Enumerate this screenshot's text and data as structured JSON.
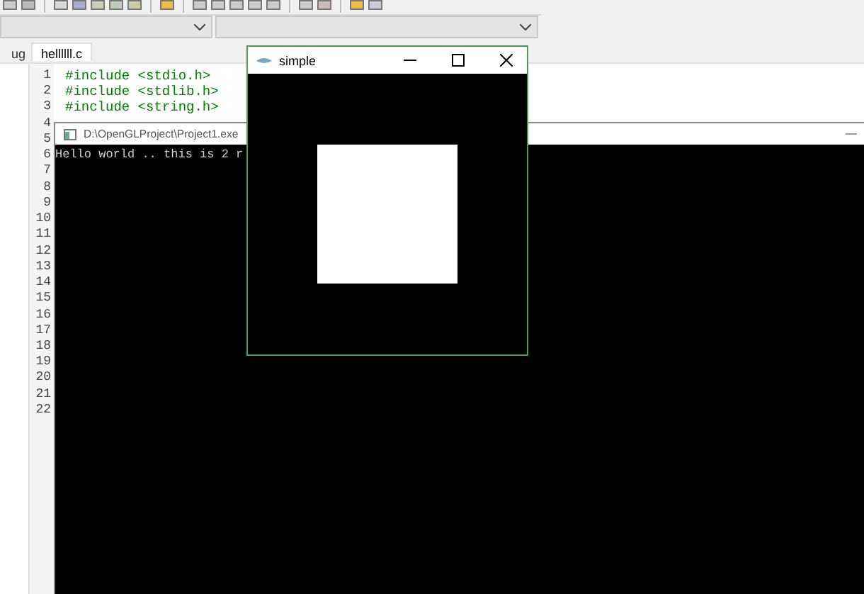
{
  "ide": {
    "side_tab": "ug",
    "file_tabs": [
      {
        "label": "hellllll.c",
        "selected": true
      }
    ],
    "line_numbers": [
      "1",
      "2",
      "3",
      "4",
      "5",
      "6",
      "7",
      "8",
      "9",
      "10",
      "11",
      "12",
      "13",
      "14",
      "15",
      "16",
      "17",
      "18",
      "19",
      "20",
      "21",
      "22"
    ],
    "code_lines": [
      "#include <stdio.h>",
      "#include <stdlib.h>",
      "#include <string.h>"
    ]
  },
  "console": {
    "title": "D:\\OpenGLProject\\Project1.exe",
    "output": "Hello world .. this is 2 r"
  },
  "glut_window": {
    "title": "simple"
  }
}
